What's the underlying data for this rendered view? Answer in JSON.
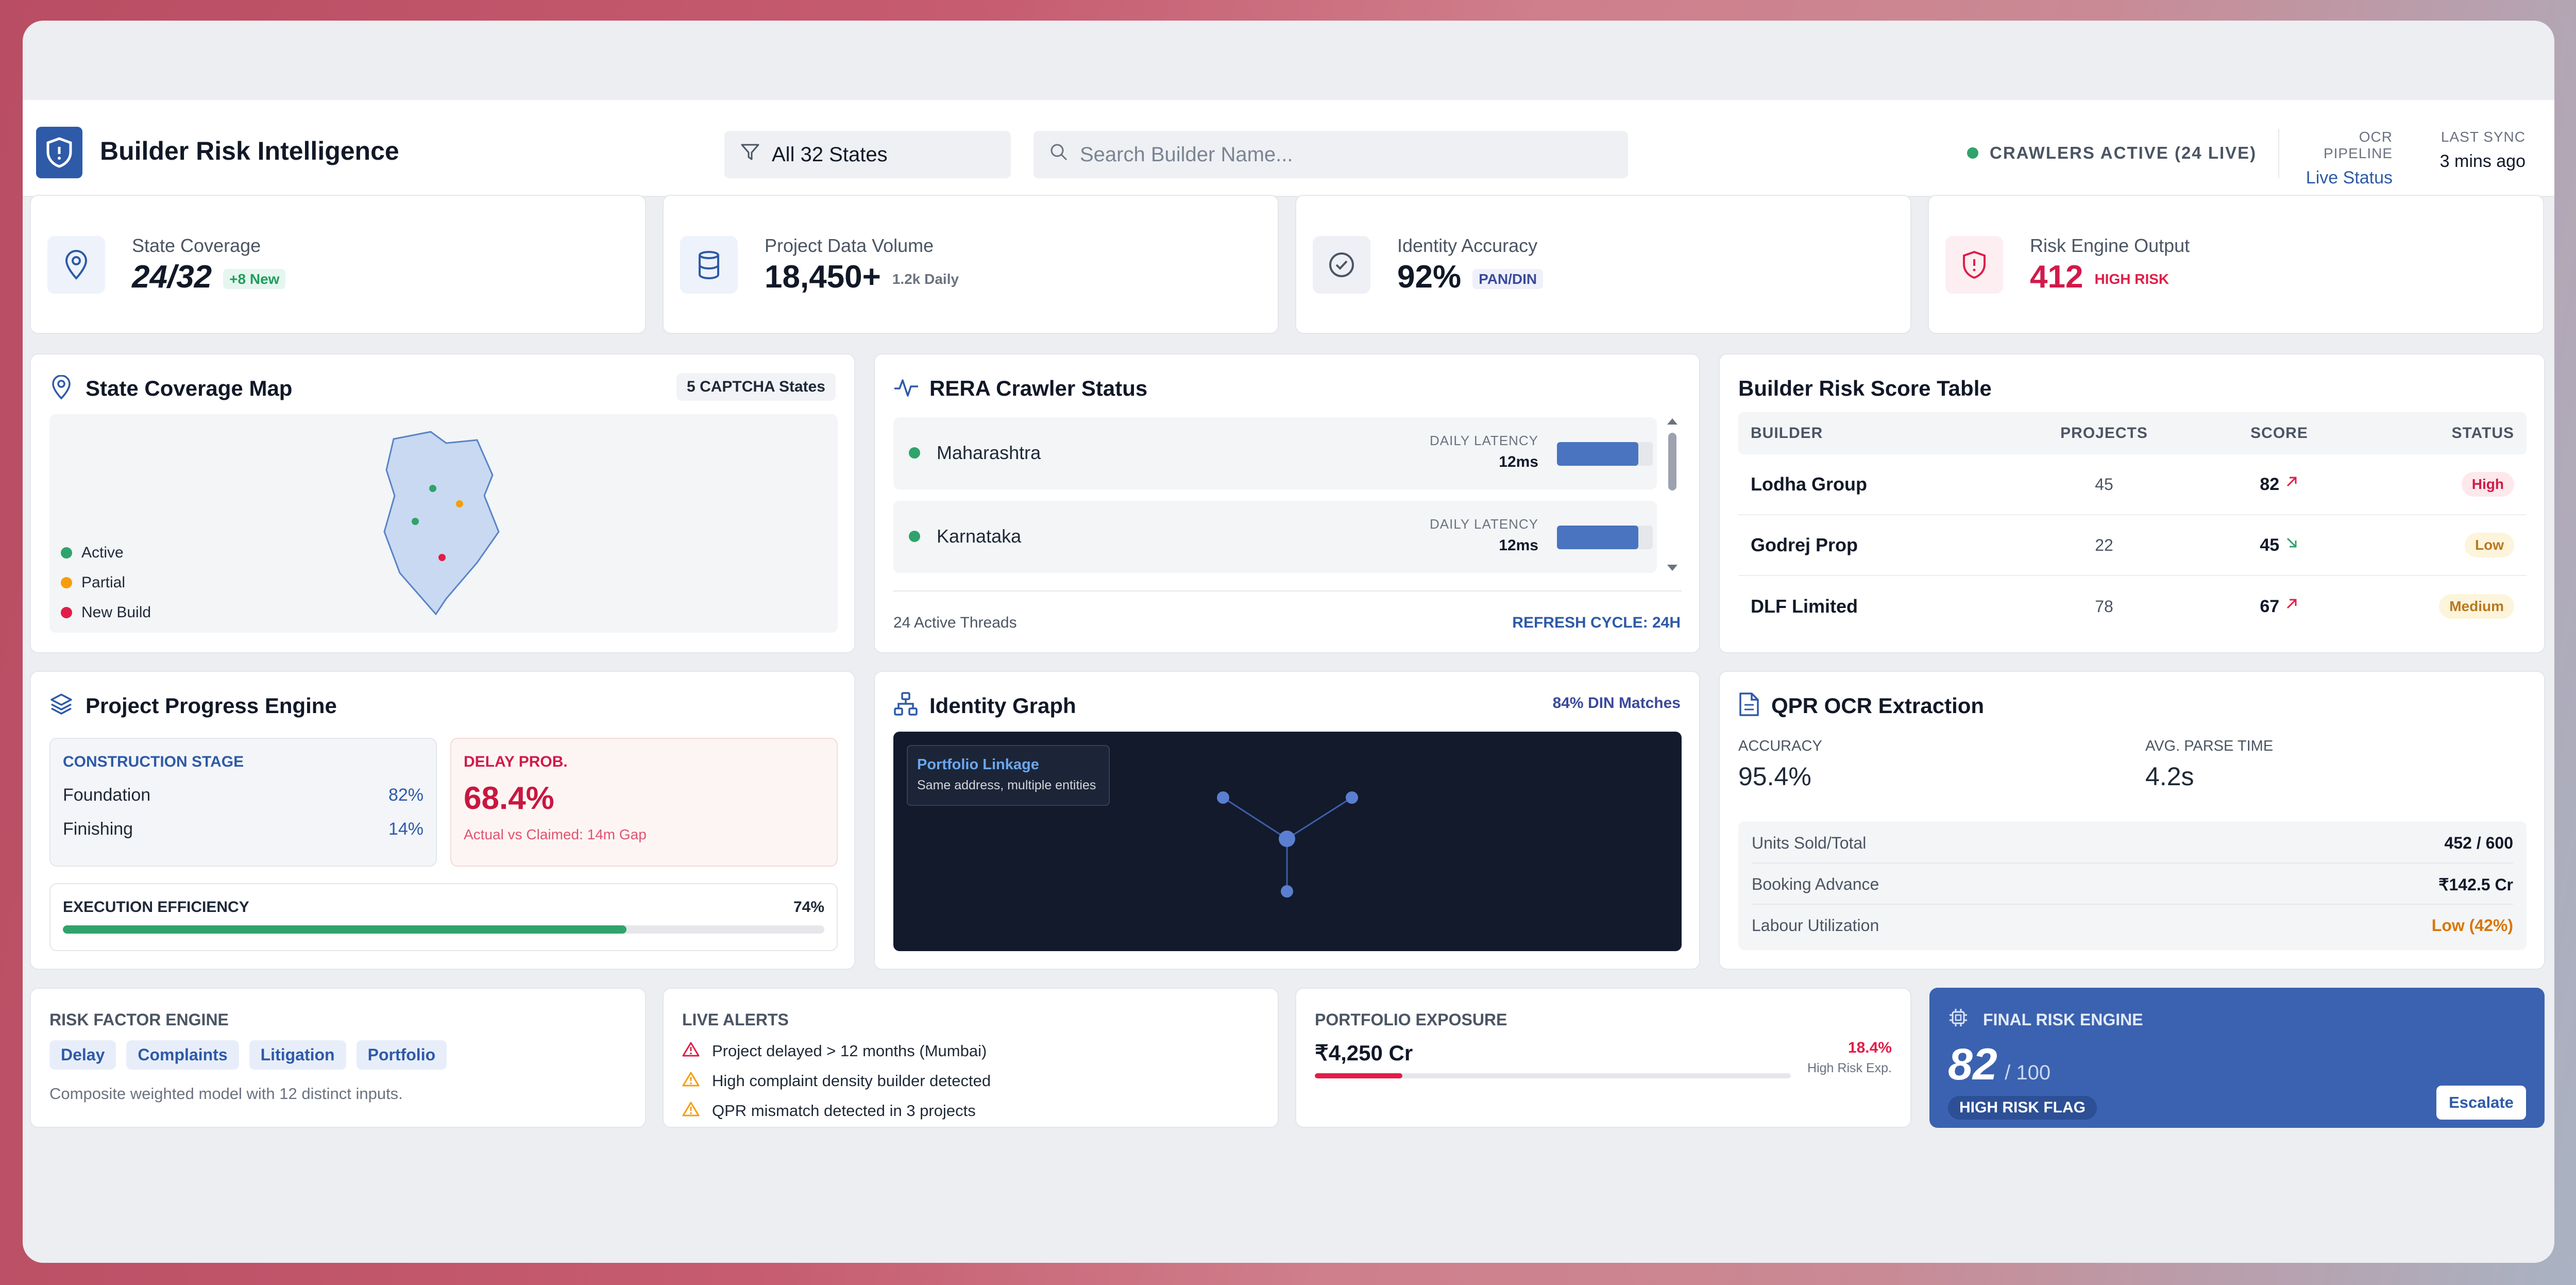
{
  "app": {
    "title": "Builder Risk Intelligence"
  },
  "header": {
    "state_filter": "All 32 States",
    "search_placeholder": "Search Builder Name...",
    "crawlers_status": "CRAWLERS ACTIVE (24 LIVE)",
    "ocr_label": "OCR PIPELINE",
    "ocr_link": "Live Status",
    "sync_label": "LAST SYNC",
    "sync_value": "3 mins ago"
  },
  "kpis": [
    {
      "label": "State Coverage",
      "value": "24/32",
      "sub": "+8 New",
      "icon": "map-pin-icon"
    },
    {
      "label": "Project Data Volume",
      "value": "18,450+",
      "sub": "1.2k Daily",
      "icon": "database-icon"
    },
    {
      "label": "Identity Accuracy",
      "value": "92%",
      "sub": "PAN/DIN",
      "icon": "check-circle-icon"
    },
    {
      "label": "Risk Engine Output",
      "value": "412",
      "sub": "HIGH RISK",
      "icon": "shield-alert-icon"
    }
  ],
  "map_card": {
    "title": "State Coverage Map",
    "pill": "5 CAPTCHA States",
    "legend": [
      {
        "label": "Active",
        "color": "#2fa36b"
      },
      {
        "label": "Partial",
        "color": "#f59e0b"
      },
      {
        "label": "New Build",
        "color": "#e11d48"
      }
    ]
  },
  "crawler_card": {
    "title": "RERA Crawler Status",
    "rows": [
      {
        "state": "Maharashtra",
        "latency_label": "DAILY LATENCY",
        "latency": "12ms",
        "load": 0.85
      },
      {
        "state": "Karnataka",
        "latency_label": "DAILY LATENCY",
        "latency": "12ms",
        "load": 0.85
      }
    ],
    "threads": "24 Active Threads",
    "refresh": "REFRESH CYCLE: 24H"
  },
  "risk_table": {
    "title": "Builder Risk Score Table",
    "columns": [
      "BUILDER",
      "PROJECTS",
      "SCORE",
      "STATUS"
    ],
    "rows": [
      {
        "builder": "Lodha Group",
        "projects": "45",
        "score": "82",
        "trend": "up",
        "status": "High"
      },
      {
        "builder": "Godrej Prop",
        "projects": "22",
        "score": "45",
        "trend": "down",
        "status": "Low"
      },
      {
        "builder": "DLF Limited",
        "projects": "78",
        "score": "67",
        "trend": "up",
        "status": "Medium"
      }
    ]
  },
  "progress_card": {
    "title": "Project Progress Engine",
    "stage_label": "CONSTRUCTION STAGE",
    "stages": [
      {
        "name": "Foundation",
        "pct": "82%"
      },
      {
        "name": "Finishing",
        "pct": "14%"
      }
    ],
    "delay_label": "DELAY PROB.",
    "delay_value": "68.4%",
    "delay_note": "Actual vs Claimed: 14m Gap",
    "efficiency_label": "EXECUTION EFFICIENCY",
    "efficiency_value": "74%",
    "efficiency_fraction": 0.74
  },
  "identity_card": {
    "title": "Identity Graph",
    "matches": "84% DIN Matches",
    "tooltip_title": "Portfolio Linkage",
    "tooltip_text": "Same address, multiple entities"
  },
  "ocr_card": {
    "title": "QPR OCR Extraction",
    "accuracy_label": "ACCURACY",
    "accuracy": "95.4%",
    "parse_label": "AVG. PARSE TIME",
    "parse": "4.2s",
    "rows": [
      {
        "label": "Units Sold/Total",
        "value": "452 / 600"
      },
      {
        "label": "Booking Advance",
        "value": "₹142.5 Cr"
      },
      {
        "label": "Labour Utilization",
        "value": "Low (42%)"
      }
    ]
  },
  "risk_factor": {
    "title": "RISK FACTOR ENGINE",
    "tags": [
      "Delay",
      "Complaints",
      "Litigation",
      "Portfolio"
    ],
    "note": "Composite weighted model with 12 distinct inputs."
  },
  "alerts": {
    "title": "LIVE ALERTS",
    "items": [
      {
        "text": "Project delayed > 12 months (Mumbai)",
        "color": "#e11d48"
      },
      {
        "text": "High complaint density builder detected",
        "color": "#f59e0b"
      },
      {
        "text": "QPR mismatch detected in 3 projects",
        "color": "#f59e0b"
      }
    ]
  },
  "exposure": {
    "title": "PORTFOLIO EXPOSURE",
    "value": "₹4,250 Cr",
    "pct": "18.4%",
    "pct_label": "High Risk Exp.",
    "fraction": 0.184
  },
  "final_risk": {
    "title": "FINAL RISK ENGINE",
    "score": "82",
    "out_of": "/ 100",
    "flag": "HIGH RISK FLAG",
    "button": "Escalate"
  },
  "colors": {
    "brand": "#2e5aa8",
    "danger": "#e11d48",
    "success": "#2fa36b",
    "warning": "#f59e0b"
  }
}
